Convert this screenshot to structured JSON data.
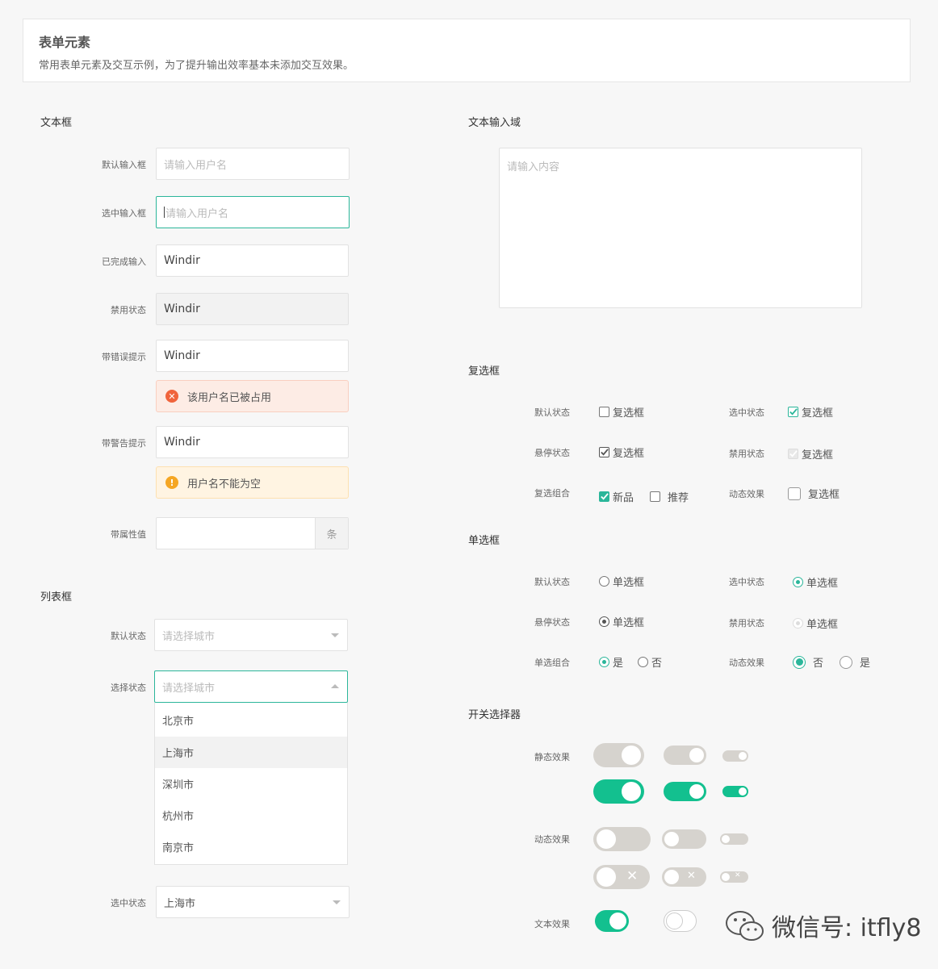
{
  "header": {
    "title": "表单元素",
    "subtitle": "常用表单元素及交互示例，为了提升输出效率基本未添加交互效果。"
  },
  "textbox": {
    "section_title": "文本框",
    "default": {
      "label": "默认输入框",
      "placeholder": "请输入用户名"
    },
    "focused": {
      "label": "选中输入框",
      "placeholder": "请输入用户名"
    },
    "filled": {
      "label": "已完成输入",
      "value": "Windir"
    },
    "disabled": {
      "label": "禁用状态",
      "value": "Windir"
    },
    "error": {
      "label": "带错误提示",
      "value": "Windir",
      "message": "该用户名已被占用"
    },
    "warning": {
      "label": "带警告提示",
      "value": "Windir",
      "message": "用户名不能为空"
    },
    "addon": {
      "label": "带属性值",
      "value": "",
      "unit": "条"
    }
  },
  "listbox": {
    "section_title": "列表框",
    "default": {
      "label": "默认状态",
      "placeholder": "请选择城市"
    },
    "open": {
      "label": "选择状态",
      "placeholder": "请选择城市",
      "options": [
        "北京市",
        "上海市",
        "深圳市",
        "杭州市",
        "南京市"
      ],
      "highlighted": "上海市"
    },
    "selected": {
      "label": "选中状态",
      "value": "上海市"
    }
  },
  "textarea": {
    "section_title": "文本输入域",
    "placeholder": "请输入内容"
  },
  "checkbox": {
    "section_title": "复选框",
    "default": {
      "label": "默认状态",
      "text": "复选框"
    },
    "checked": {
      "label": "选中状态",
      "text": "复选框"
    },
    "hover": {
      "label": "悬停状态",
      "text": "复选框"
    },
    "disabled": {
      "label": "禁用状态",
      "text": "复选框"
    },
    "group": {
      "label": "复选组合",
      "items": [
        "新品",
        "推荐"
      ]
    },
    "dynamic": {
      "label": "动态效果",
      "text": "复选框"
    }
  },
  "radio": {
    "section_title": "单选框",
    "default": {
      "label": "默认状态",
      "text": "单选框"
    },
    "checked": {
      "label": "选中状态",
      "text": "单选框"
    },
    "hover": {
      "label": "悬停状态",
      "text": "单选框"
    },
    "disabled": {
      "label": "禁用状态",
      "text": "单选框"
    },
    "group": {
      "label": "单选组合",
      "items": [
        "是",
        "否"
      ]
    },
    "dynamic": {
      "label": "动态效果",
      "items": [
        "否",
        "是"
      ]
    }
  },
  "switch": {
    "section_title": "开关选择器",
    "static_label": "静态效果",
    "dynamic_label": "动态效果",
    "text_label": "文本效果"
  },
  "watermark": "微信号: itfly8",
  "colors": {
    "accent": "#2bb69a",
    "switch_on": "#13c08f",
    "error": "#f0643c",
    "warning": "#f5a623"
  }
}
